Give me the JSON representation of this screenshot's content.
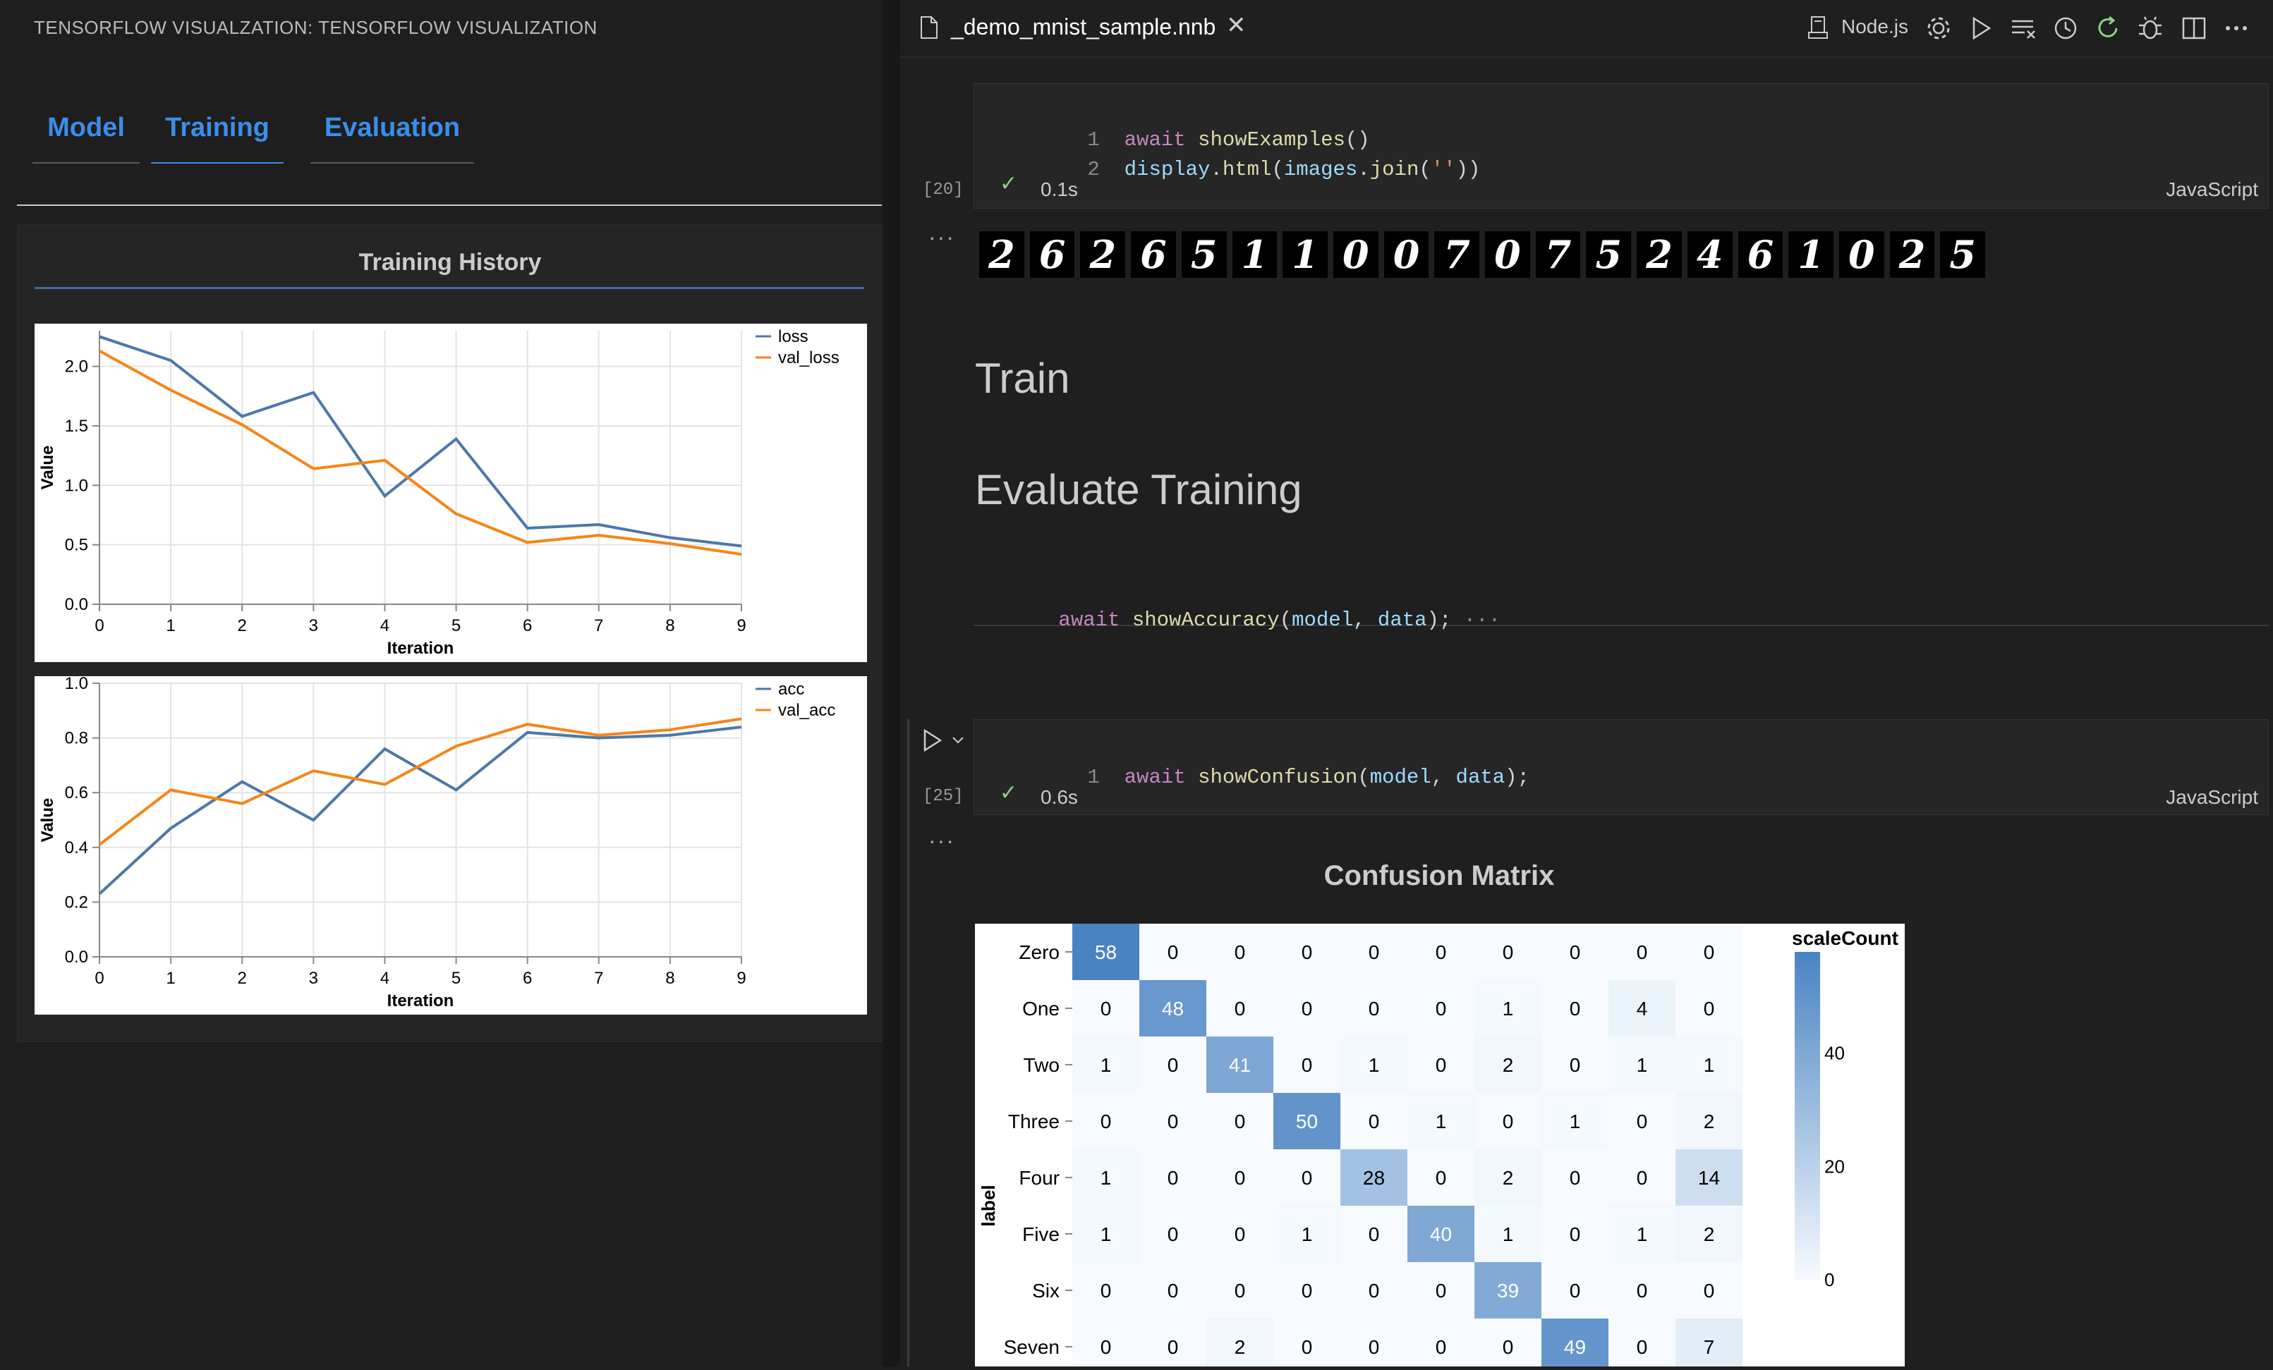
{
  "left_panel": {
    "title": "TENSORFLOW VISUALZATION: TENSORFLOW VISUALIZATION",
    "tabs": [
      {
        "label": "Model",
        "active": false
      },
      {
        "label": "Training",
        "active": true
      },
      {
        "label": "Evaluation",
        "active": false
      }
    ],
    "section_title": "Training History"
  },
  "editor": {
    "file_name": "_demo_mnist_sample.nnb",
    "kernel": "Node.js",
    "toolbar_icons": [
      "gear-icon",
      "run-all-icon",
      "clear-outputs-icon",
      "history-icon",
      "restart-icon",
      "debug-icon",
      "split-editor-icon",
      "more-icon"
    ],
    "cells": [
      {
        "exec_count": "[20]",
        "lines": [
          {
            "num": "1",
            "tokens": [
              [
                "kw",
                "await "
              ],
              [
                "fn",
                "showExamples"
              ],
              [
                "punc",
                "()"
              ]
            ]
          },
          {
            "num": "2",
            "tokens": [
              [
                "var",
                "display"
              ],
              [
                "punc",
                "."
              ],
              [
                "fn",
                "html"
              ],
              [
                "punc",
                "("
              ],
              [
                "var",
                "images"
              ],
              [
                "punc",
                "."
              ],
              [
                "fn",
                "join"
              ],
              [
                "punc",
                "("
              ],
              [
                "str",
                "''"
              ],
              [
                "punc",
                "))"
              ]
            ]
          }
        ],
        "time": "0.1s",
        "language": "JavaScript"
      },
      {
        "exec_count": "[25]",
        "lines": [
          {
            "num": "1",
            "tokens": [
              [
                "kw",
                "await "
              ],
              [
                "fn",
                "showConfusion"
              ],
              [
                "punc",
                "("
              ],
              [
                "var",
                "model"
              ],
              [
                "punc",
                ", "
              ],
              [
                "var",
                "data"
              ],
              [
                "punc",
                ");"
              ]
            ]
          }
        ],
        "time": "0.6s",
        "language": "JavaScript"
      }
    ],
    "digits": [
      "2",
      "6",
      "2",
      "6",
      "5",
      "1",
      "1",
      "0",
      "0",
      "7",
      "0",
      "7",
      "5",
      "2",
      "4",
      "6",
      "1",
      "0",
      "2",
      "5"
    ],
    "markdown_train": "Train",
    "markdown_evaluate": "Evaluate Training",
    "collapsed_cell_tokens": [
      [
        "kw",
        "await "
      ],
      [
        "fn",
        "showAccuracy"
      ],
      [
        "punc",
        "("
      ],
      [
        "var",
        "model"
      ],
      [
        "punc",
        ", "
      ],
      [
        "var",
        "data"
      ],
      [
        "punc",
        ");"
      ]
    ],
    "collapsed_marker": "···",
    "output_marker": "···"
  },
  "chart_data": [
    {
      "type": "line",
      "xlabel": "Iteration",
      "ylabel": "Value",
      "x": [
        0,
        1,
        2,
        3,
        4,
        5,
        6,
        7,
        8,
        9
      ],
      "ylim": [
        0,
        2.3
      ],
      "yticks": [
        "0.0",
        "0.5",
        "1.0",
        "1.5",
        "2.0"
      ],
      "legend": "top-right",
      "series": [
        {
          "name": "loss",
          "color": "#4c78a8",
          "values": [
            2.25,
            2.05,
            1.58,
            1.78,
            0.91,
            1.39,
            0.64,
            0.67,
            0.56,
            0.49
          ]
        },
        {
          "name": "val_loss",
          "color": "#f58518",
          "values": [
            2.13,
            1.8,
            1.51,
            1.14,
            1.21,
            0.76,
            0.52,
            0.58,
            0.51,
            0.42
          ]
        }
      ]
    },
    {
      "type": "line",
      "xlabel": "Iteration",
      "ylabel": "Value",
      "x": [
        0,
        1,
        2,
        3,
        4,
        5,
        6,
        7,
        8,
        9
      ],
      "ylim": [
        0,
        1.0
      ],
      "yticks": [
        "0.0",
        "0.2",
        "0.4",
        "0.6",
        "0.8",
        "1.0"
      ],
      "legend": "top-right",
      "series": [
        {
          "name": "acc",
          "color": "#4c78a8",
          "values": [
            0.23,
            0.47,
            0.64,
            0.5,
            0.76,
            0.61,
            0.82,
            0.8,
            0.81,
            0.84
          ]
        },
        {
          "name": "val_acc",
          "color": "#f58518",
          "values": [
            0.41,
            0.61,
            0.56,
            0.68,
            0.63,
            0.77,
            0.85,
            0.81,
            0.83,
            0.87
          ]
        }
      ]
    },
    {
      "type": "heatmap",
      "title": "Confusion Matrix",
      "ylabel": "label",
      "legend_title": "scaleCount",
      "legend_ticks": [
        "0",
        "20",
        "40"
      ],
      "color_max": 58,
      "rows": [
        "Zero",
        "One",
        "Two",
        "Three",
        "Four",
        "Five",
        "Six",
        "Seven"
      ],
      "values": [
        [
          58,
          0,
          0,
          0,
          0,
          0,
          0,
          0,
          0,
          0
        ],
        [
          0,
          48,
          0,
          0,
          0,
          0,
          1,
          0,
          4,
          0
        ],
        [
          1,
          0,
          41,
          0,
          1,
          0,
          2,
          0,
          1,
          1
        ],
        [
          0,
          0,
          0,
          50,
          0,
          1,
          0,
          1,
          0,
          2
        ],
        [
          1,
          0,
          0,
          0,
          28,
          0,
          2,
          0,
          0,
          14
        ],
        [
          1,
          0,
          0,
          1,
          0,
          40,
          1,
          0,
          1,
          2
        ],
        [
          0,
          0,
          0,
          0,
          0,
          0,
          39,
          0,
          0,
          0
        ],
        [
          0,
          0,
          2,
          0,
          0,
          0,
          0,
          49,
          0,
          7
        ]
      ]
    }
  ]
}
